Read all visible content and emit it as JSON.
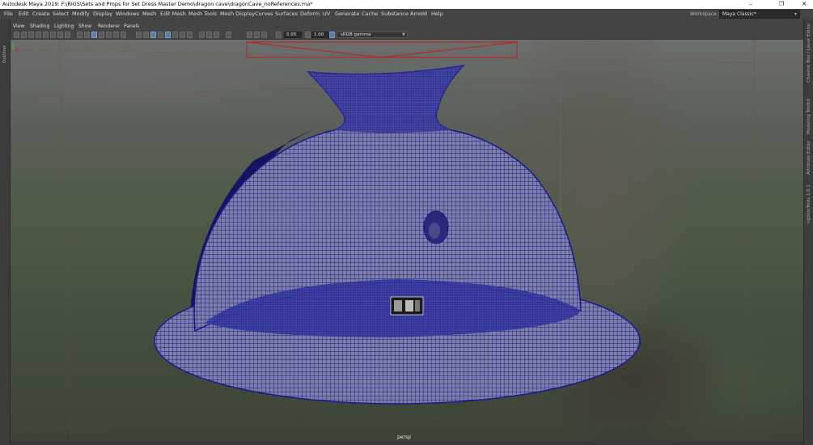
{
  "window": {
    "title": "Autodesk Maya 2019: F:\\RIGS\\Sets and Props for Set Dress Master Demo\\dragon cave\\dragonCave_noReferences.ma*",
    "minimize": "–",
    "maximize": "❐",
    "close": "✕"
  },
  "menubar": {
    "items": [
      "File",
      "Edit",
      "Create",
      "Select",
      "Modify",
      "Display",
      "Windows",
      "Mesh",
      "Edit Mesh",
      "Mesh Tools",
      "Mesh Display",
      "Curves",
      "Surfaces",
      "Deform",
      "UV",
      "Generate",
      "Cache",
      "Substance",
      "Arnold",
      "Help"
    ],
    "workspace_label": "Workspace :",
    "workspace_value": "Maya Classic*"
  },
  "left_strip": {
    "label": "Outliner"
  },
  "panel_menu": {
    "items": [
      "View",
      "Shading",
      "Lighting",
      "Show",
      "Renderer",
      "Panels"
    ]
  },
  "toolbar": {
    "exposure": "0.00",
    "gamma": "1.00",
    "color_space": "sRGB gamma"
  },
  "viewport": {
    "camera_label": "persp",
    "mesh_color": "#1a1a8c",
    "axis_x_color": "#d03030",
    "axis_y_color": "#40c040"
  },
  "right_strip": {
    "tabs": [
      "Channel Box / Layer Editor",
      "Modeling Toolkit",
      "Attribute Editor",
      "ngSkinTools 1.6.1"
    ]
  }
}
